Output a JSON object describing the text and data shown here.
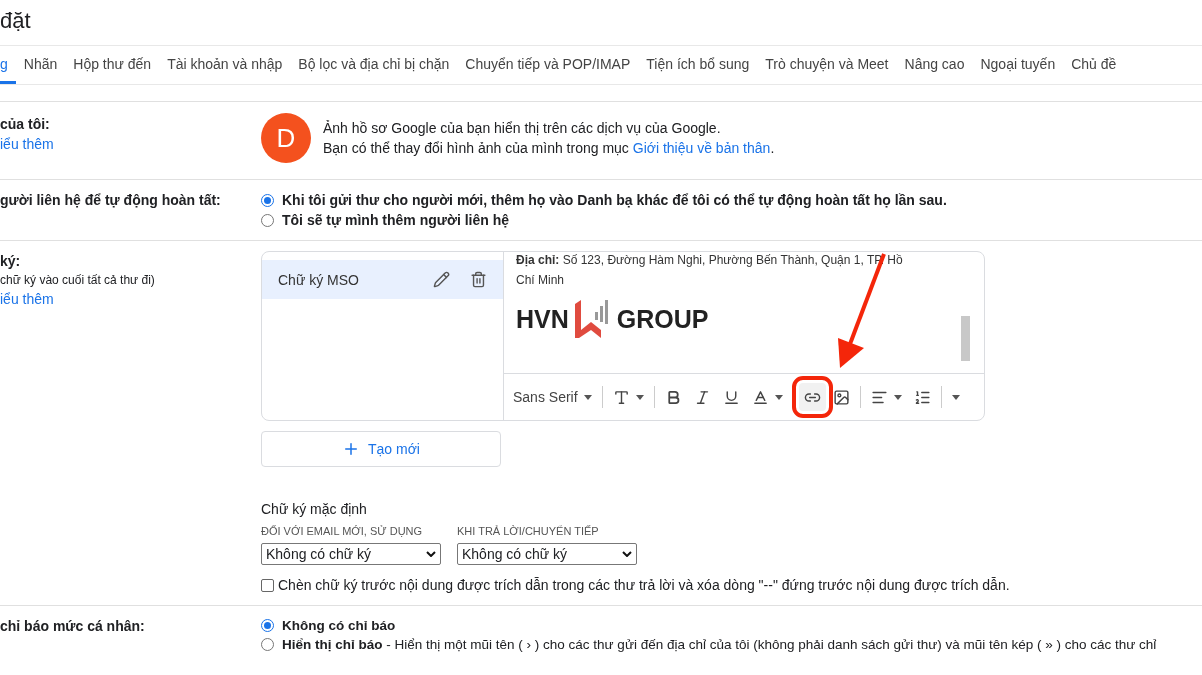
{
  "page_title": "đặt",
  "tabs": [
    {
      "label": "g",
      "selected": true
    },
    {
      "label": "Nhãn",
      "selected": false
    },
    {
      "label": "Hộp thư đến",
      "selected": false
    },
    {
      "label": "Tài khoản và nhập",
      "selected": false
    },
    {
      "label": "Bộ lọc và địa chỉ bị chặn",
      "selected": false
    },
    {
      "label": "Chuyển tiếp và POP/IMAP",
      "selected": false
    },
    {
      "label": "Tiện ích bổ sung",
      "selected": false
    },
    {
      "label": "Trò chuyện và Meet",
      "selected": false
    },
    {
      "label": "Nâng cao",
      "selected": false
    },
    {
      "label": "Ngoại tuyến",
      "selected": false
    },
    {
      "label": "Chủ đề",
      "selected": false
    }
  ],
  "profile": {
    "label": "của tôi:",
    "link": "iểu thêm",
    "avatar_letter": "D",
    "line_1": "Ảnh hồ sơ Google của bạn hiển thị trên các dịch vụ của Google.",
    "line_2_before": "Bạn có thể thay đổi hình ảnh của mình trong mục",
    "line_2_link": "Giới thiệu về bản thân",
    "line_2_after": "."
  },
  "autocomplete": {
    "label": "gười liên hệ để tự động hoàn tất:",
    "options": [
      {
        "label": "Khi tôi gửi thư cho người mới, thêm họ vào Danh bạ khác để tôi có thể tự động hoàn tất họ lần sau.",
        "selected": true
      },
      {
        "label": "Tôi sẽ tự mình thêm người liên hệ",
        "selected": false
      }
    ]
  },
  "signature": {
    "label": "ký:",
    "hint": "chữ ký vào cuối tất cả thư đi)",
    "link": "iểu thêm",
    "items": [
      {
        "name": "Chữ ký MSO",
        "selected": true
      }
    ],
    "editor": {
      "address_label": "Địa chỉ:",
      "address": "Số 123, Đường Hàm Nghi, Phường Bến Thành, Quận 1, TP. Hồ",
      "address_cont": "Chí Minh",
      "logo_left": "HVN",
      "logo_right": "GROUP"
    },
    "toolbar": {
      "font": "Sans Serif",
      "buttons": [
        {
          "kind": "size",
          "highlighted": false
        },
        {
          "kind": "bold",
          "highlighted": false
        },
        {
          "kind": "italic",
          "highlighted": false
        },
        {
          "kind": "underline",
          "highlighted": false
        },
        {
          "kind": "color",
          "highlighted": false
        },
        {
          "kind": "link",
          "highlighted": true
        },
        {
          "kind": "image",
          "highlighted": false
        },
        {
          "kind": "align",
          "highlighted": false
        },
        {
          "kind": "numbered",
          "highlighted": false
        },
        {
          "kind": "more",
          "highlighted": false
        }
      ]
    },
    "create_button": "Tạo mới",
    "defaults": {
      "title": "Chữ ký mặc định",
      "fields": [
        {
          "label": "ĐỐI VỚI EMAIL MỚI, SỬ DỤNG",
          "value": "Không có chữ ký"
        },
        {
          "label": "KHI TRẢ LỜI/CHUYỂN TIẾP",
          "value": "Không có chữ ký"
        }
      ],
      "checkbox": {
        "label": "Chèn chữ ký trước nội dung được trích dẫn trong các thư trả lời và xóa dòng \"--\" đứng trước nội dung được trích dẫn.",
        "checked": false
      }
    }
  },
  "indicators": {
    "label": "chỉ báo mức cá nhân:",
    "options": [
      {
        "label": "Không có chỉ báo",
        "selected": true
      },
      {
        "label": "Hiển thị chỉ báo",
        "detail": "- Hiển thị một mũi tên ( › ) cho các thư gửi đến địa chỉ của tôi (không phải danh sách gửi thư) và mũi tên kép ( » ) cho các thư chỉ",
        "selected": false
      }
    ]
  },
  "annotations": [
    {
      "kind": "arrow"
    }
  ]
}
